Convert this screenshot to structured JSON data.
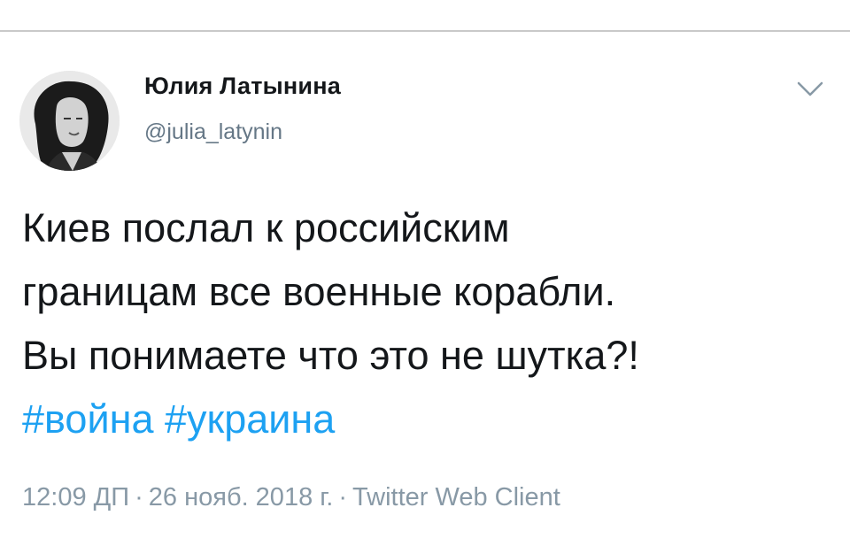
{
  "author": {
    "name": "Юлия Латынина",
    "handle": "@julia_latynin"
  },
  "tweet": {
    "lines": [
      "Киев послал к российским",
      "границам все военные корабли.",
      "Вы понимаете что это не шутка?!"
    ],
    "hashtags": [
      "#война",
      "#украина"
    ]
  },
  "meta": {
    "time": "12:09 ДП",
    "separator": "·",
    "date": "26 нояб. 2018 г.",
    "client": "Twitter Web Client"
  },
  "icons": {
    "avatar": "profile-photo",
    "more": "chevron-down-icon"
  },
  "colors": {
    "text": "#14171a",
    "secondary": "#657786",
    "meta": "#8899a6",
    "link": "#1da1f2"
  }
}
